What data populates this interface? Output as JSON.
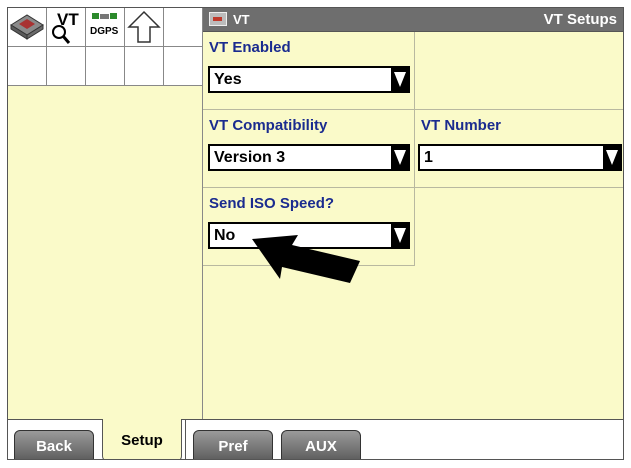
{
  "header": {
    "title": "VT",
    "page_title": "VT Setups"
  },
  "icon_grid": {
    "icons": [
      {
        "name": "book-magnifier-icon"
      },
      {
        "name": "vt-icon",
        "label": "VT"
      },
      {
        "name": "dgps-icon",
        "label": "DGPS"
      },
      {
        "name": "up-arrow-icon"
      }
    ]
  },
  "settings": {
    "vt_enabled": {
      "label": "VT Enabled",
      "value": "Yes"
    },
    "vt_compatibility": {
      "label": "VT Compatibility",
      "value": "Version 3"
    },
    "vt_number": {
      "label": "VT Number",
      "value": "1"
    },
    "send_iso_speed": {
      "label": "Send ISO Speed?",
      "value": "No"
    }
  },
  "tabs": [
    {
      "label": "Back",
      "state": "normal"
    },
    {
      "label": "Setup",
      "state": "active"
    },
    {
      "label": "Pref",
      "state": "normal"
    },
    {
      "label": "AUX",
      "state": "normal"
    }
  ],
  "colors": {
    "panel_background": "#fafac9",
    "label_text": "#1a2b8f",
    "header_background": "#6e6e6e"
  }
}
